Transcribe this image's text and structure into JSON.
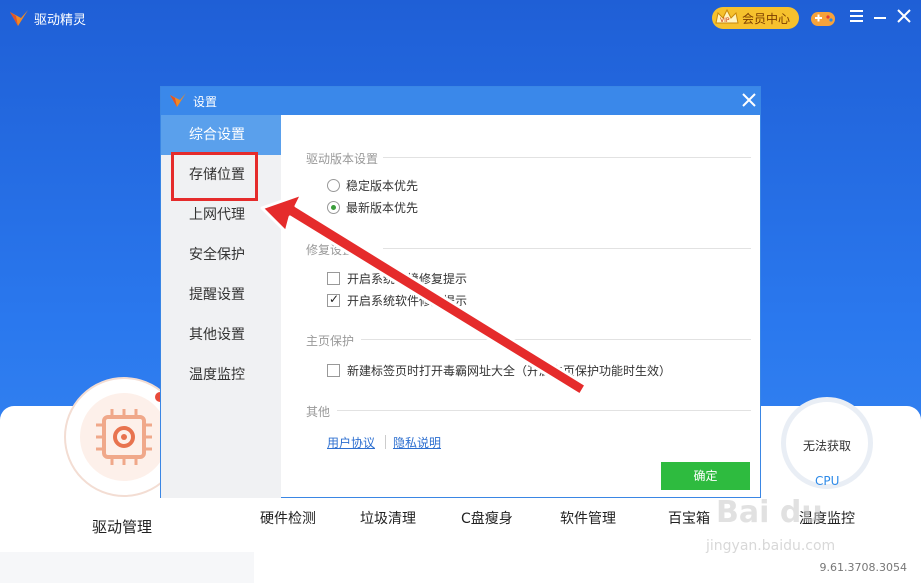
{
  "app": {
    "title": "驱动精灵"
  },
  "header": {
    "vip_label": "会员中心",
    "vip_badge": "VIP",
    "icons": [
      "vip-crown-icon",
      "gamepad-icon",
      "menu-icon",
      "minimize-icon",
      "close-icon"
    ]
  },
  "main": {
    "primary_feature": "驱动管理",
    "features": [
      "硬件检测",
      "垃圾清理",
      "C盘瘦身",
      "软件管理",
      "百宝箱",
      "温度监控"
    ],
    "temp_status": "无法获取",
    "cpu_label": "CPU",
    "version": "9.61.3708.3054"
  },
  "dialog": {
    "title": "设置",
    "sidebar": [
      {
        "label": "综合设置",
        "active": true
      },
      {
        "label": "存储位置",
        "active": false
      },
      {
        "label": "上网代理",
        "active": false
      },
      {
        "label": "安全保护",
        "active": false
      },
      {
        "label": "提醒设置",
        "active": false
      },
      {
        "label": "其他设置",
        "active": false
      },
      {
        "label": "温度监控",
        "active": false
      }
    ],
    "sections": {
      "driver_version": {
        "title": "驱动版本设置",
        "options": [
          {
            "label": "稳定版本优先",
            "selected": false
          },
          {
            "label": "最新版本优先",
            "selected": true
          }
        ]
      },
      "repair": {
        "title": "修复设置",
        "options": [
          {
            "label": "开启系统环境修复提示",
            "checked": false
          },
          {
            "label": "开启系统软件修复提示",
            "checked": true
          }
        ]
      },
      "homepage": {
        "title": "主页保护",
        "options": [
          {
            "label": "新建标签页时打开毒霸网址大全（开启主页保护功能时生效）",
            "checked": false
          }
        ]
      },
      "other": {
        "title": "其他",
        "links": [
          "用户协议",
          "隐私说明"
        ]
      }
    },
    "ok_label": "确定"
  },
  "watermark": {
    "brand": "Bai du",
    "url": "jingyan.baidu.com"
  },
  "colors": {
    "background": "#2a78ee",
    "dialog_title": "#3a88ea",
    "nav_active": "#5aa0ec",
    "ok_button": "#2ebb3f",
    "annotation": "#e52b2b",
    "vip": "#f6c12d"
  }
}
